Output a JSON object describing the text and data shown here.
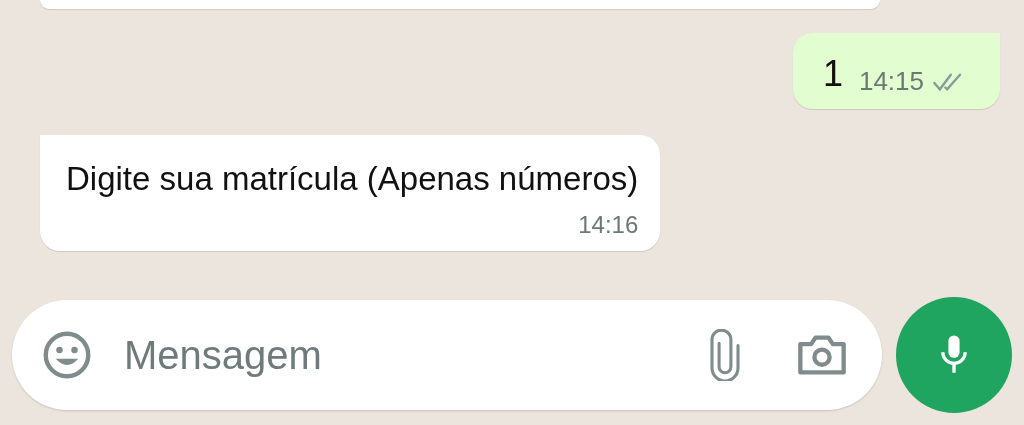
{
  "messages": [
    {
      "kind": "out",
      "text": "1",
      "time": "14:15",
      "read": false
    },
    {
      "kind": "in",
      "text": "Digite sua matrícula (Apenas números)",
      "time": "14:16"
    }
  ],
  "composer": {
    "placeholder": "Mensagem"
  }
}
